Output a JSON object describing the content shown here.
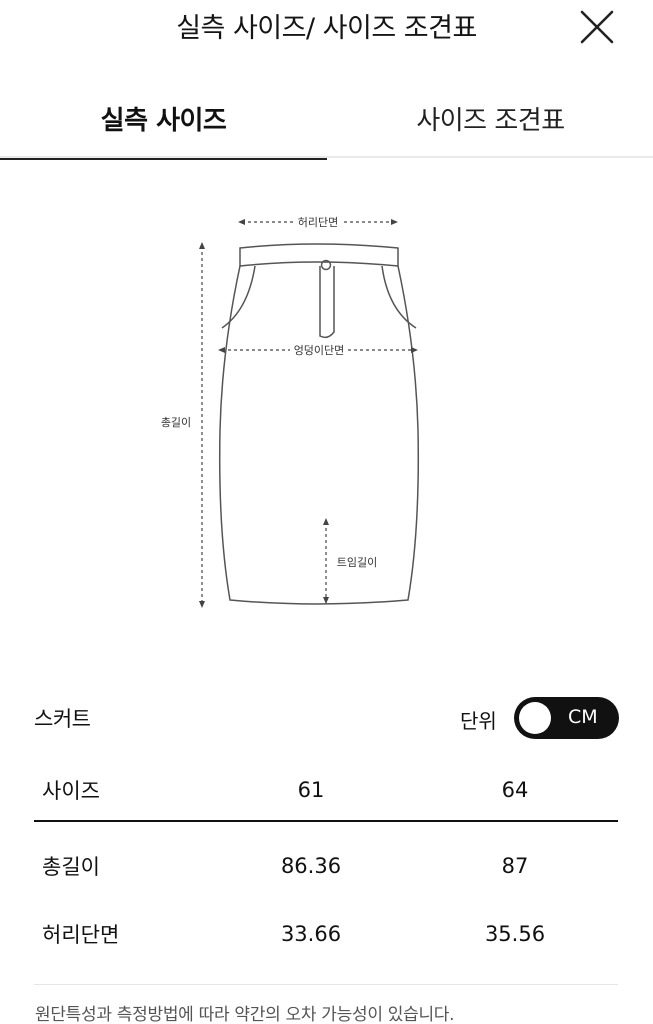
{
  "header": {
    "title": "실측 사이즈/ 사이즈 조견표"
  },
  "tabs": [
    {
      "label": "실측 사이즈",
      "active": true
    },
    {
      "label": "사이즈 조견표",
      "active": false
    }
  ],
  "diagram": {
    "labels": {
      "waist": "허리단면",
      "hip": "엉덩이단면",
      "total_length": "총길이",
      "slit_length": "트임길이"
    }
  },
  "section": {
    "title": "스커트",
    "unit_label": "단위",
    "unit_value": "CM"
  },
  "table": {
    "header": {
      "label": "사이즈",
      "sizes": [
        "61",
        "64"
      ]
    },
    "rows": [
      {
        "label": "총길이",
        "values": [
          "86.36",
          "87"
        ]
      },
      {
        "label": "허리단면",
        "values": [
          "33.66",
          "35.56"
        ]
      }
    ]
  },
  "note": "원단특성과 측정방법에 따라 약간의 오차 가능성이 있습니다.",
  "colors": {
    "text": "#111111",
    "toggle_bg": "#111111",
    "divider": "#e9e9e9",
    "note_text": "#555555"
  },
  "icons": {
    "close": "close-icon"
  }
}
